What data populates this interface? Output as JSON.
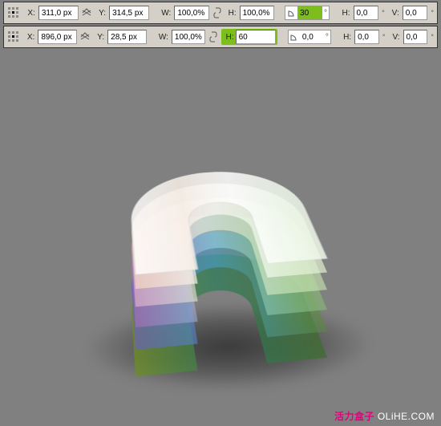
{
  "toolbar1": {
    "x_label": "X:",
    "x_value": "311,0 px",
    "y_label": "Y:",
    "y_value": "314,5 px",
    "w_label": "W:",
    "w_value": "100,0%",
    "h_label": "H:",
    "h_value": "100,0%",
    "rot_value": "30",
    "skew_h_label": "H:",
    "skew_h_value": "0,0",
    "skew_v_label": "V:",
    "skew_v_value": "0,0"
  },
  "toolbar2": {
    "x_label": "X:",
    "x_value": "896,0 px",
    "y_label": "Y:",
    "y_value": "28,5 px",
    "w_label": "W:",
    "w_value": "100,0%",
    "h_label": "H:",
    "h_value": "60",
    "rot_value": "0,0",
    "skew_h_label": "H:",
    "skew_h_value": "0,0",
    "skew_v_label": "V:",
    "skew_v_value": "0,0"
  },
  "watermark": {
    "brand": "活力盒子",
    "domain": "OLiHE.COM"
  }
}
